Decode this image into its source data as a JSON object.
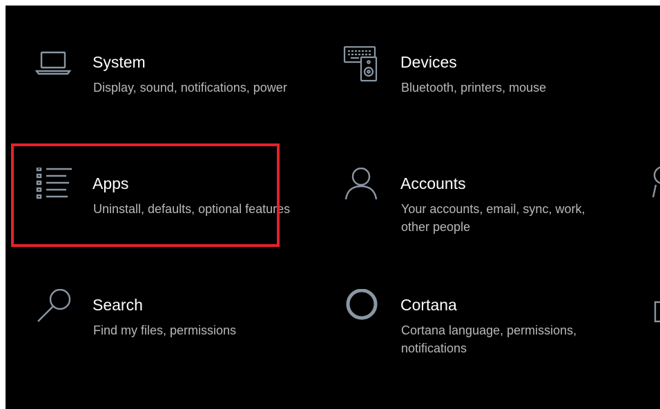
{
  "colors": {
    "background": "#000000",
    "title": "#ffffff",
    "description": "#b9b9b9",
    "icon_stroke": "#8a97a4",
    "highlight": "#e8202a"
  },
  "tiles": [
    {
      "key": "system",
      "icon": "laptop-icon",
      "title": "System",
      "description": "Display, sound, notifications, power"
    },
    {
      "key": "devices",
      "icon": "devices-icon",
      "title": "Devices",
      "description": "Bluetooth, printers, mouse"
    },
    {
      "key": "apps",
      "icon": "apps-list-icon",
      "title": "Apps",
      "description": "Uninstall, defaults, optional features"
    },
    {
      "key": "accounts",
      "icon": "person-icon",
      "title": "Accounts",
      "description": "Your accounts, email, sync, work, other people"
    },
    {
      "key": "search",
      "icon": "search-icon",
      "title": "Search",
      "description": "Find my files, permissions"
    },
    {
      "key": "cortana",
      "icon": "cortana-icon",
      "title": "Cortana",
      "description": "Cortana language, permissions, notifications"
    }
  ],
  "highlighted_tile": "apps",
  "partial_icons": [
    "time-language-icon",
    "privacy-icon"
  ]
}
